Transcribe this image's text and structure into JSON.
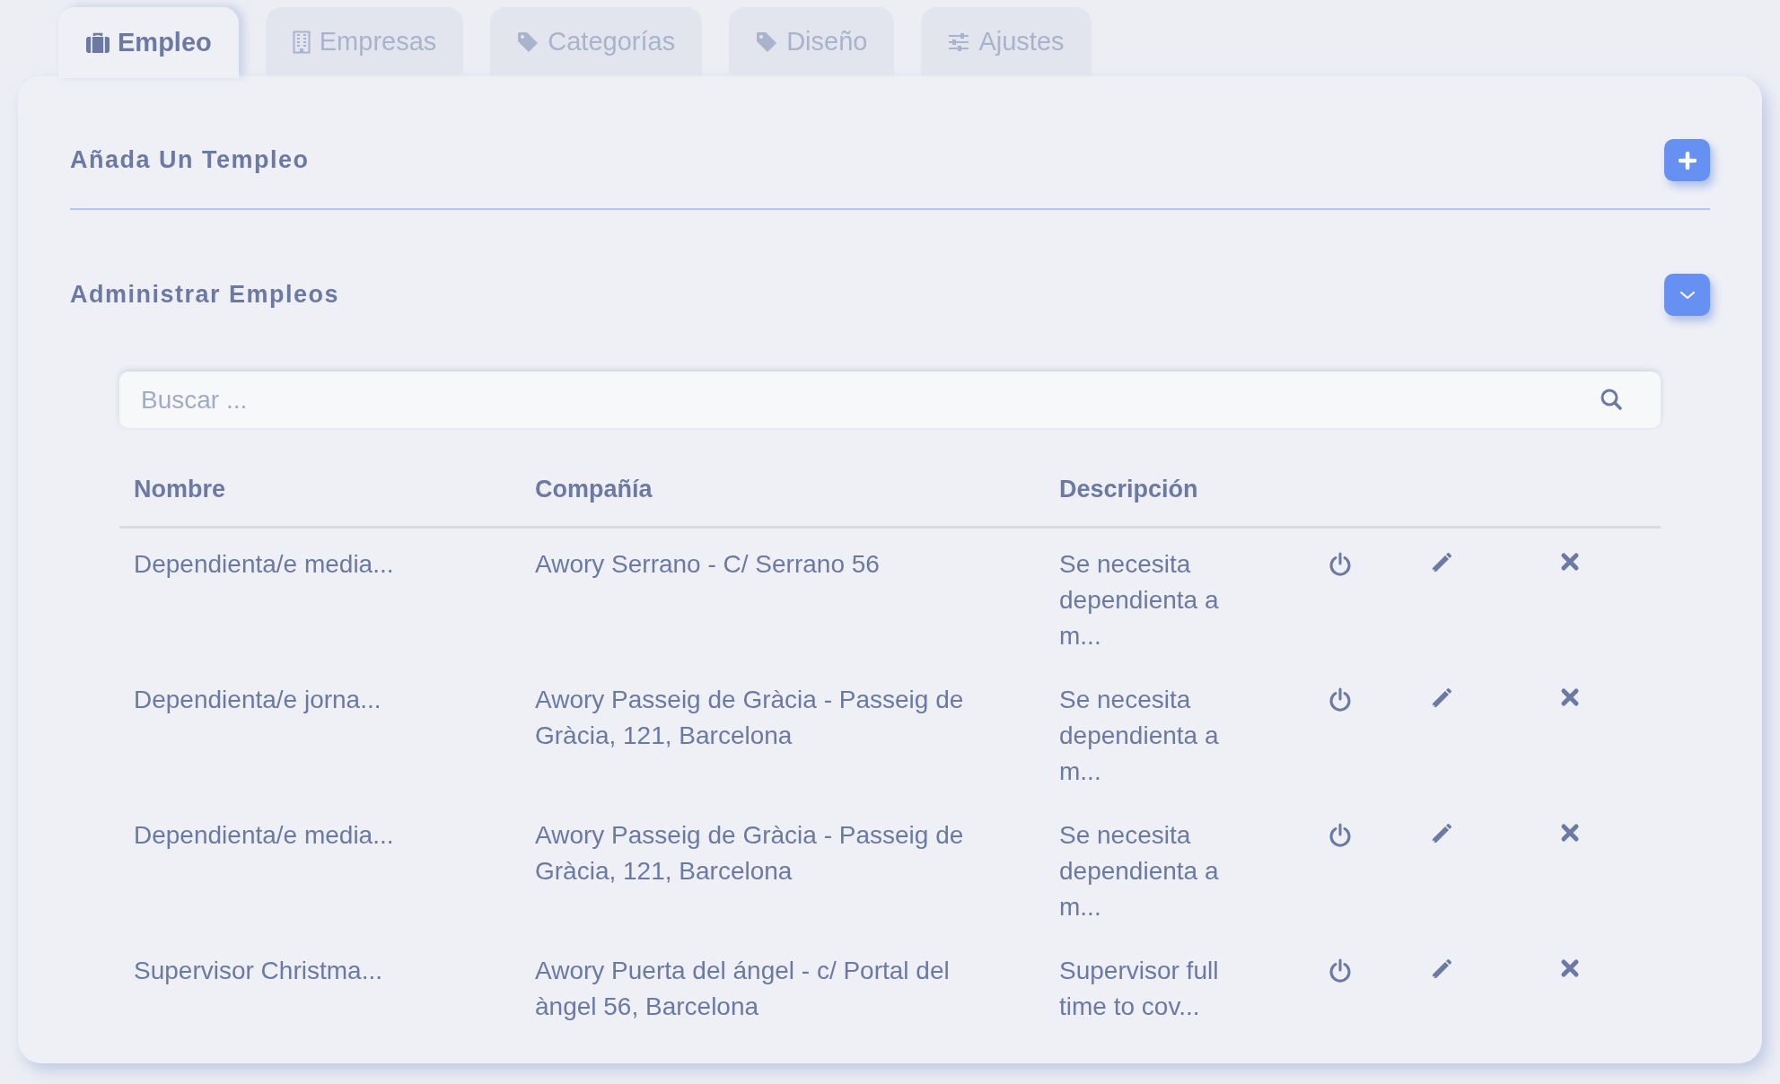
{
  "tabs": [
    {
      "label": "Empleo",
      "selected": true
    },
    {
      "label": "Empresas",
      "selected": false
    },
    {
      "label": "Categorías",
      "selected": false
    },
    {
      "label": "Diseño",
      "selected": false
    },
    {
      "label": "Ajustes",
      "selected": false
    }
  ],
  "add_section": {
    "title": "Añada Un Templeo"
  },
  "manage_section": {
    "title": "Administrar Empleos",
    "expanded": true
  },
  "search": {
    "placeholder": "Buscar ..."
  },
  "table": {
    "columns": [
      "Nombre",
      "Compañía",
      "Descripción"
    ],
    "rows": [
      {
        "name": "Dependienta/e media...",
        "company": "Awory Serrano - C/ Serrano 56",
        "description": "Se necesita dependienta a m..."
      },
      {
        "name": "Dependienta/e jorna...",
        "company": "Awory Passeig de Gràcia - Passeig de Gràcia, 121, Barcelona",
        "description": "Se necesita dependienta a m..."
      },
      {
        "name": "Dependienta/e media...",
        "company": "Awory Passeig de Gràcia - Passeig de Gràcia, 121, Barcelona",
        "description": "Se necesita dependienta a m..."
      },
      {
        "name": "Supervisor Christma...",
        "company": "Awory Puerta del ángel - c/ Portal del àngel 56, Barcelona",
        "description": "Supervisor full time to cov..."
      }
    ]
  }
}
